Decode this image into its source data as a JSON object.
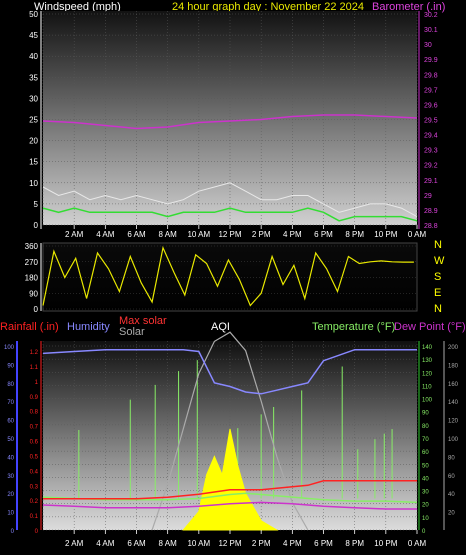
{
  "header": {
    "wind_label": "Windspeed (mph)",
    "title": "24 hour graph day : November 22 2024",
    "baro_label": "Barometer (.in)"
  },
  "compass": [
    "N",
    "W",
    "S",
    "E",
    "N"
  ],
  "legend": {
    "rainfall": "Rainfall (.in)",
    "humidity": "Humidity",
    "max_solar": "Max solar",
    "solar": "Solar",
    "aqi": "AQI",
    "temperature": "Temperature (°F)",
    "dew_point": "Dew Point (°F)"
  },
  "time_ticks": [
    "2 AM",
    "4 AM",
    "6 AM",
    "8 AM",
    "10 AM",
    "12 PM",
    "2 PM",
    "4 PM",
    "6 PM",
    "8 PM",
    "10 PM",
    "0 AM"
  ],
  "colors": {
    "wind_gust": "#e8e8e8",
    "wind_avg": "#33dd33",
    "barometer": "#cc33cc",
    "direction": "#e8e800",
    "rain": "#ff2222",
    "humidity": "#8888ff",
    "max_solar": "#aaaaaa",
    "solar": "#ffff00",
    "temperature": "#88ee66",
    "dew_point": "#cc33cc"
  },
  "chart_data": [
    {
      "type": "line",
      "panel": "wind-barometer",
      "title": "24 hour graph day : November 22 2024",
      "x_range_hours": [
        0,
        24
      ],
      "y_left": {
        "label": "Windspeed (mph)",
        "ticks": [
          "0",
          "5",
          "10",
          "15",
          "20",
          "25",
          "30",
          "35",
          "40",
          "45",
          "50"
        ],
        "ylim": [
          0,
          50
        ]
      },
      "y_right": {
        "label": "Barometer (.in)",
        "ticks": [
          "28.8",
          "28.9",
          "29",
          "29.1",
          "29.2",
          "29.3",
          "29.4",
          "29.5",
          "29.6",
          "29.7",
          "29.8",
          "29.9",
          "30",
          "30.1",
          "30.2"
        ],
        "ylim": [
          28.8,
          30.2
        ]
      },
      "series": [
        {
          "name": "Barometer (.in)",
          "axis": "right",
          "x": [
            0,
            2,
            4,
            6,
            8,
            10,
            12,
            14,
            16,
            18,
            20,
            22,
            24
          ],
          "values": [
            29.49,
            29.48,
            29.46,
            29.44,
            29.45,
            29.48,
            29.49,
            29.5,
            29.52,
            29.53,
            29.53,
            29.52,
            29.51
          ]
        },
        {
          "name": "Windspeed (mph)",
          "axis": "left",
          "x": [
            0,
            1,
            2,
            3,
            4,
            5,
            6,
            7,
            8,
            9,
            10,
            11,
            12,
            13,
            14,
            15,
            16,
            17,
            18,
            19,
            20,
            21,
            22,
            23,
            24
          ],
          "gust": [
            9,
            7,
            8,
            6,
            7,
            6,
            7,
            6,
            5,
            6,
            8,
            9,
            10,
            8,
            6,
            6,
            7,
            7,
            5,
            3,
            4,
            5,
            5,
            4,
            2
          ],
          "values": [
            4,
            3,
            4,
            3,
            3,
            3,
            3,
            3,
            2,
            3,
            3,
            3,
            4,
            3,
            3,
            3,
            3,
            4,
            3,
            1,
            2,
            2,
            2,
            2,
            1
          ]
        }
      ]
    },
    {
      "type": "scatter",
      "panel": "wind-direction",
      "y_ticks": [
        "0",
        "90",
        "180",
        "270",
        "360"
      ],
      "ylim": [
        0,
        360
      ],
      "x": [
        0,
        0.7,
        1.4,
        2.1,
        2.8,
        3.5,
        4.2,
        4.9,
        5.6,
        6.3,
        7,
        7.7,
        8.4,
        9.1,
        9.8,
        10.5,
        11.2,
        11.9,
        12.6,
        13.3,
        14,
        14.7,
        15.4,
        16.1,
        16.8,
        17.5,
        18.2,
        18.9,
        19.6,
        20.3,
        21,
        21.7,
        22.4,
        23.1,
        23.8
      ],
      "values": [
        20,
        330,
        180,
        290,
        60,
        320,
        230,
        100,
        300,
        150,
        40,
        350,
        210,
        80,
        310,
        260,
        130,
        280,
        170,
        20,
        90,
        300,
        140,
        250,
        60,
        320,
        230,
        100,
        300,
        260,
        270,
        275,
        270,
        268,
        268
      ]
    },
    {
      "type": "line",
      "panel": "multi",
      "y_ticks_rain": [
        "0",
        "0.1",
        "0.2",
        "0.3",
        "0.4",
        "0.5",
        "0.6",
        "0.7",
        "0.8",
        "0.9",
        "1",
        "1.1",
        "1.2"
      ],
      "y_ticks_humidity": [
        "0",
        "10",
        "20",
        "30",
        "40",
        "50",
        "60",
        "70",
        "80",
        "90",
        "100"
      ],
      "y_ticks_temp": [
        "0",
        "10",
        "20",
        "30",
        "40",
        "50",
        "60",
        "70",
        "80",
        "90",
        "100",
        "110",
        "120",
        "130",
        "140"
      ],
      "y_ticks_solar": [
        "20",
        "40",
        "60",
        "80",
        "100",
        "120",
        "140",
        "160",
        "180",
        "200"
      ],
      "series": [
        {
          "name": "Humidity",
          "x": [
            0,
            2,
            4,
            6,
            8,
            9,
            10,
            11,
            12,
            13,
            14,
            15,
            16,
            17,
            18,
            20,
            22,
            24
          ],
          "values": [
            96,
            97,
            98,
            98,
            98,
            98,
            97,
            80,
            78,
            75,
            74,
            76,
            78,
            80,
            92,
            98,
            98,
            98
          ]
        },
        {
          "name": "Temperature (°F)",
          "x": [
            0,
            2,
            4,
            6,
            8,
            10,
            12,
            13,
            14,
            16,
            18,
            20,
            22,
            24
          ],
          "values": [
            25,
            24,
            23,
            23,
            23,
            24,
            27,
            28,
            27,
            25,
            23,
            22,
            22,
            21
          ]
        },
        {
          "name": "Dew Point (°F)",
          "x": [
            0,
            2,
            4,
            6,
            8,
            10,
            12,
            14,
            16,
            18,
            20,
            22,
            24
          ],
          "values": [
            19,
            18,
            17,
            17,
            17,
            18,
            20,
            21,
            20,
            18,
            17,
            16,
            16
          ]
        },
        {
          "name": "Rainfall (.in)",
          "x": [
            0,
            6,
            8,
            10,
            12,
            14,
            16,
            17,
            18,
            24
          ],
          "values": [
            0.21,
            0.21,
            0.22,
            0.24,
            0.27,
            0.27,
            0.29,
            0.3,
            0.33,
            0.33
          ]
        },
        {
          "name": "Max solar",
          "x": [
            7,
            8,
            9,
            10,
            11,
            12,
            13,
            14,
            15,
            16,
            17
          ],
          "values": [
            0,
            50,
            110,
            170,
            205,
            215,
            195,
            140,
            80,
            30,
            0
          ]
        },
        {
          "name": "Solar",
          "x": [
            9,
            10,
            10.5,
            11,
            11.5,
            12,
            12.5,
            13,
            14,
            15
          ],
          "values": [
            0,
            20,
            60,
            80,
            60,
            110,
            70,
            40,
            10,
            0
          ]
        }
      ]
    }
  ]
}
